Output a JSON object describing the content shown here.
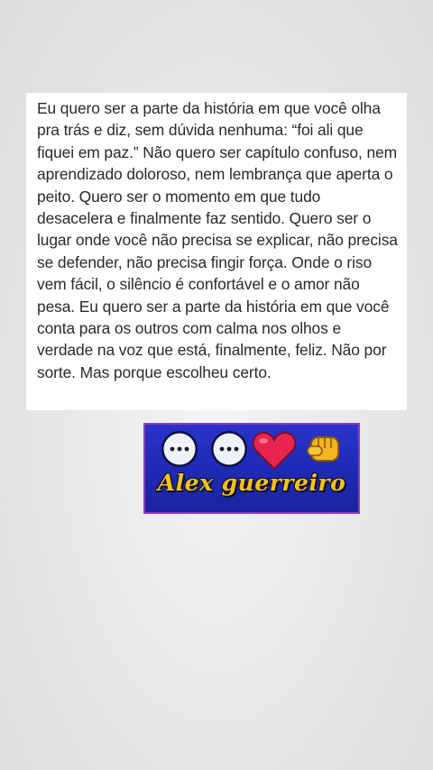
{
  "post": {
    "text": "Eu quero ser a parte da história em que você olha pra trás e diz, sem dúvida nenhuma: “foi ali que fiquei em paz.” Não quero ser capítulo confuso, nem aprendizado doloroso, nem lembrança que aperta o peito. Quero ser o momento em que tudo desacelera e finalmente faz sentido. Quero ser o lugar onde você não precisa se explicar, não precisa se defender, não precisa fingir força. Onde o riso vem fácil, o silêncio é confortável e o amor não pesa. Eu quero ser a parte da história em que você conta para os outros com calma nos olhos e verdade na voz que está, finalmente, feliz. Não por sorte. Mas porque escolheu certo."
  },
  "banner": {
    "signature": "Alex guerreiro",
    "icons": [
      "chat-bubble-icon",
      "chat-bubble-icon",
      "heart-icon",
      "fist-icon"
    ],
    "colors": {
      "background": "#2a33c9",
      "border": "#8a3fb8",
      "signature": "#f4c21b",
      "heart": "#e8244f",
      "bubble": "#eef2fb",
      "fist": "#f2b51f"
    }
  }
}
